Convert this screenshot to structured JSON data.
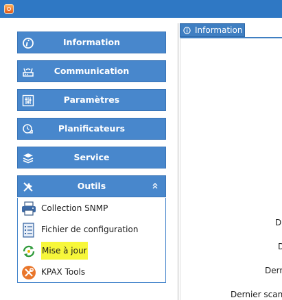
{
  "sidebar": {
    "panels": [
      {
        "label": "Information",
        "icon": "info-icon"
      },
      {
        "label": "Communication",
        "icon": "network-icon"
      },
      {
        "label": "Paramètres",
        "icon": "sliders-icon"
      },
      {
        "label": "Planificateurs",
        "icon": "scheduler-clock-icon"
      },
      {
        "label": "Service",
        "icon": "service-stack-icon"
      }
    ],
    "tools": {
      "label": "Outils",
      "icon": "tools-icon",
      "items": [
        {
          "label": "Collection SNMP",
          "icon": "printer-icon"
        },
        {
          "label": "Fichier de configuration",
          "icon": "config-file-icon"
        },
        {
          "label": "Mise à jour",
          "icon": "update-refresh-icon",
          "highlighted": true
        },
        {
          "label": "KPAX Tools",
          "icon": "kpax-tools-icon"
        }
      ]
    }
  },
  "main": {
    "tab": {
      "label": "Information",
      "icon": "info-icon"
    },
    "field_labels": [
      "D",
      "D",
      "Derni",
      "Dernier scan"
    ]
  },
  "colors": {
    "accent": "#4887cc",
    "titlebar": "#2f78c4",
    "highlight": "#f7f73a"
  }
}
